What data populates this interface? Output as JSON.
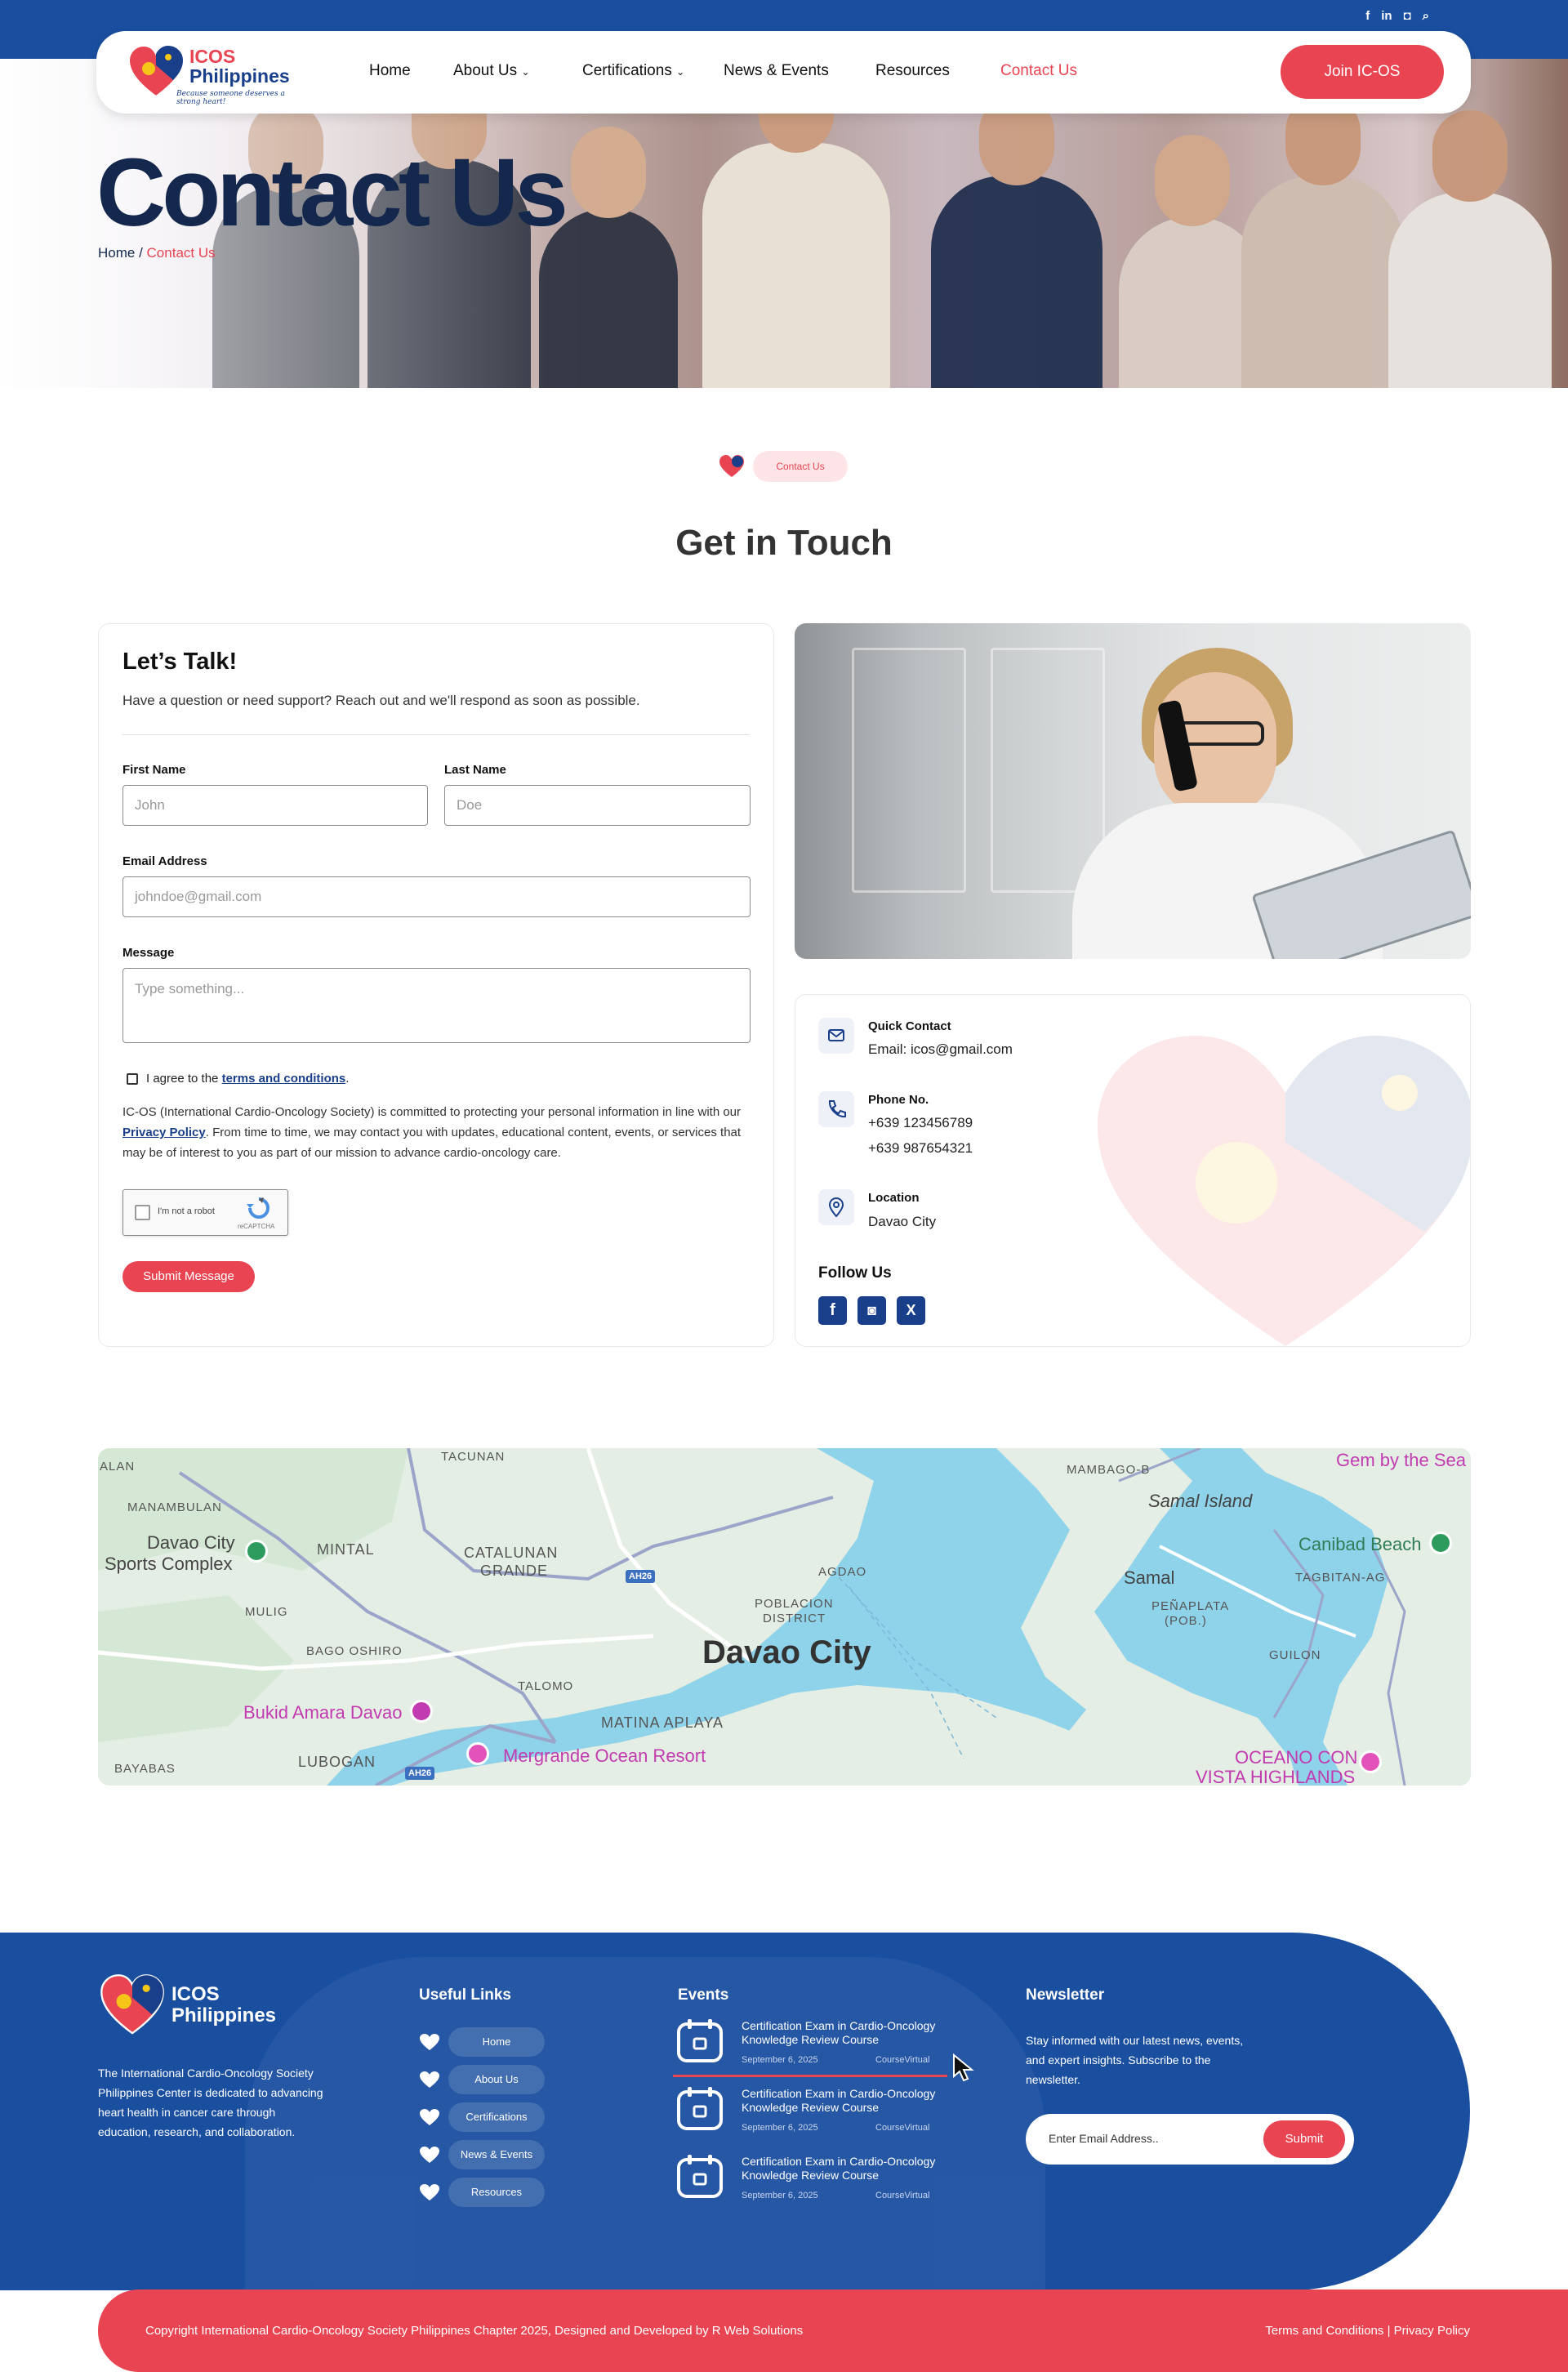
{
  "colors": {
    "primary_blue": "#1a4fa0",
    "navy": "#14284d",
    "accent_red": "#e84451",
    "badge_pink": "#fde4e6"
  },
  "topbar": {
    "icons": [
      "facebook-icon",
      "linkedin-icon",
      "instagram-icon",
      "search-icon"
    ],
    "glyphs": [
      "f",
      "in",
      "◘",
      "⌕"
    ]
  },
  "nav": {
    "logo_line1": "ICOS",
    "logo_line2": "Philippines",
    "logo_tagline": "Because someone deserves a strong heart!",
    "items": [
      "Home",
      "About Us",
      "Certifications",
      "News & Events",
      "Resources",
      "Contact Us"
    ],
    "active": "Contact Us",
    "cta": "Join IC-OS"
  },
  "hero": {
    "title": "Contact Us",
    "crumb_home": "Home",
    "crumb_sep": " / ",
    "crumb_current": "Contact Us"
  },
  "section": {
    "badge": "Contact Us",
    "title": "Get in Touch"
  },
  "form": {
    "title": "Let’s Talk!",
    "subtitle": "Have a question or need support? Reach out and we'll respond as soon as possible.",
    "first_name_label": "First Name",
    "first_name_placeholder": "John",
    "last_name_label": "Last Name",
    "last_name_placeholder": "Doe",
    "email_label": "Email Address",
    "email_placeholder": "johndoe@gmail.com",
    "message_label": "Message",
    "message_placeholder": "Type something...",
    "agree_prefix": "I agree to the ",
    "agree_link": "terms and conditions",
    "agree_suffix": ".",
    "policy_part1": "IC-OS (International Cardio-Oncology Society) is committed to protecting your personal information in line with our ",
    "policy_link": "Privacy Policy",
    "policy_part2": ". From time to time, we may contact you with updates, educational content, events, or services that may be of interest to you as part of our mission to advance cardio-oncology care.",
    "captcha_label": "I'm not a robot",
    "captcha_brand": "reCAPTCHA",
    "submit": "Submit Message"
  },
  "contact": {
    "quick_title": "Quick Contact",
    "email": "Email: icos@gmail.com",
    "phone_title": "Phone No.",
    "phone1": "+639 123456789",
    "phone2": "+639 987654321",
    "location_title": "Location",
    "location": "Davao City",
    "follow": "Follow Us",
    "social": [
      "facebook-icon",
      "instagram-icon",
      "x-icon"
    ],
    "social_glyphs": [
      "f",
      "◙",
      "X"
    ]
  },
  "map": {
    "labels": {
      "alan": "ALAN",
      "tacunan": "TACUNAN",
      "manambulan": "MANAMBULAN",
      "mintal": "MINTAL",
      "catalunan": "CATALUNAN",
      "grande": "GRANDE",
      "agdao": "AGDAO",
      "poblacion": "POBLACION",
      "district": "DISTRICT",
      "mulig": "MULIG",
      "bago_oshiro": "BAGO OSHIRO",
      "talomo": "TALOMO",
      "matina": "MATINA APLAYA",
      "lubogan": "LUBOGAN",
      "bayabas": "BAYABAS",
      "mambago": "MAMBAGO-B",
      "tagbitan": "TAGBITAN-AG",
      "penaplata": "PEÑAPLATA",
      "pob": "(POB.)",
      "guilon": "GUILON"
    },
    "city": "Davao City",
    "samal_island": "Samal Island",
    "samal": "Samal",
    "sports_complex_1": "Davao City",
    "sports_complex_2": "Sports Complex",
    "gem": "Gem by the Sea",
    "canibad": "Canibad Beach",
    "bukid": "Bukid Amara Davao",
    "mergrande": "Mergrande Ocean Resort",
    "oceano_1": "OCEANO CON",
    "oceano_2": "VISTA HIGHLANDS",
    "hwy1": "AH26",
    "hwy2": "AH26"
  },
  "footer": {
    "logo_line1": "ICOS",
    "logo_line2": "Philippines",
    "about": "The International Cardio-Oncology Society Philippines Center is dedicated to advancing heart health in cancer care through education, research, and collaboration.",
    "useful_title": "Useful Links",
    "links": [
      "Home",
      "About Us",
      "Certifications",
      "News & Events",
      "Resources"
    ],
    "events_title": "Events",
    "events": [
      {
        "title": "Certification Exam in Cardio-Oncology Knowledge Review Course",
        "date": "September 6, 2025",
        "category": "CourseVirtual"
      },
      {
        "title": "Certification Exam in Cardio-Oncology Knowledge Review Course",
        "date": "September 6, 2025",
        "category": "CourseVirtual"
      },
      {
        "title": "Certification Exam in Cardio-Oncology Knowledge Review Course",
        "date": "September 6, 2025",
        "category": "CourseVirtual"
      }
    ],
    "newsletter_title": "Newsletter",
    "newsletter_text": "Stay informed with our latest news, events, and expert insights. Subscribe to the newsletter.",
    "newsletter_placeholder": "Enter Email Address..",
    "newsletter_button": "Submit",
    "copyright": "Copyright International Cardio-Oncology Society Philippines Chapter 2025, Designed and Developed by R Web Solutions",
    "terms": "Terms and Conditions | Privacy Policy"
  }
}
